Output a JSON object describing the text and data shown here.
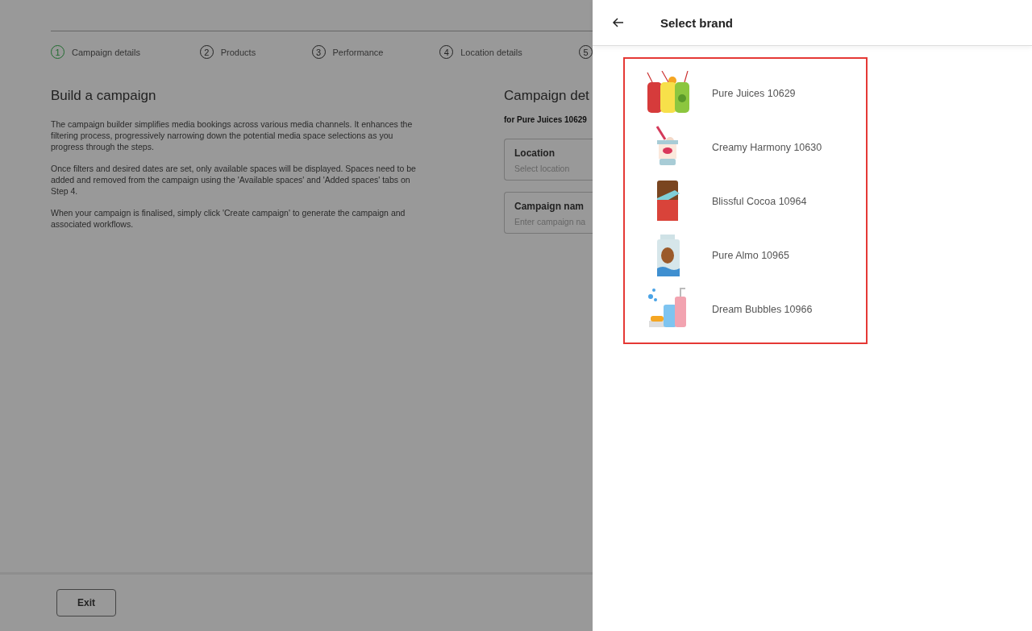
{
  "steps": [
    {
      "number": "1",
      "label": "Campaign details",
      "selected": true
    },
    {
      "number": "2",
      "label": "Products",
      "selected": false
    },
    {
      "number": "3",
      "label": "Performance",
      "selected": false
    },
    {
      "number": "4",
      "label": "Location details",
      "selected": false
    },
    {
      "number": "5",
      "selected": false
    }
  ],
  "intro": {
    "title": "Build a campaign",
    "paragraphs": [
      "The campaign builder simplifies media bookings across various media channels. It enhances the filtering process, progressively narrowing down the potential media space selections as you progress through the steps.",
      "Once filters and desired dates are set, only available spaces will be displayed. Spaces need to be added and removed from the campaign using the 'Available spaces' and 'Added spaces' tabs on Step 4.",
      "When your campaign is finalised, simply click 'Create campaign' to generate the campaign and associated workflows."
    ]
  },
  "details": {
    "title": "Campaign det",
    "subtitle": "for Pure Juices 10629",
    "fields": [
      {
        "label": "Location",
        "placeholder": "Select location"
      },
      {
        "label": "Campaign nam",
        "placeholder": "Enter campaign na"
      }
    ]
  },
  "footer": {
    "exit_button": "Exit"
  },
  "drawer": {
    "title": "Select brand",
    "brands": [
      {
        "name": "Pure Juices 10629"
      },
      {
        "name": "Creamy Harmony 10630"
      },
      {
        "name": "Blissful Cocoa 10964"
      },
      {
        "name": "Pure Almo 10965"
      },
      {
        "name": "Dream Bubbles 10966"
      }
    ]
  }
}
